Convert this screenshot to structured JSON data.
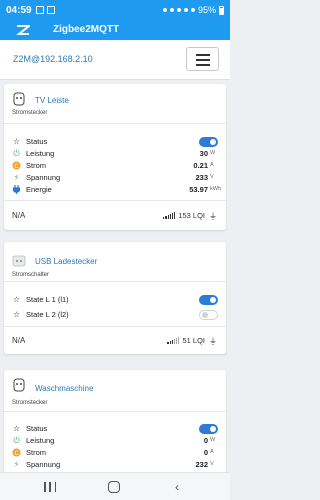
{
  "statusbar": {
    "time": "04:59",
    "battery": "95%"
  },
  "app": {
    "title": "Zigbee2MQTT"
  },
  "subheader": {
    "host": "Z2M@192.168.2.10"
  },
  "devices": [
    {
      "name": "TV Leiste",
      "type": "Stromstecker",
      "rows": [
        {
          "label": "Status",
          "toggle": "on"
        },
        {
          "label": "Leistung",
          "value": "30",
          "unit": "W"
        },
        {
          "label": "Strom",
          "value": "0.21",
          "unit": "A"
        },
        {
          "label": "Spannung",
          "value": "233",
          "unit": "V"
        },
        {
          "label": "Energie",
          "value": "53.97",
          "unit": "kWh"
        }
      ],
      "footer": {
        "status": "N/A",
        "lqi": "153 LQI"
      }
    },
    {
      "name": "USB Ladestecker",
      "type": "Stromschalter",
      "rows": [
        {
          "label": "State L 1 (l1)",
          "toggle": "on"
        },
        {
          "label": "State L 2 (l2)",
          "toggle": "off"
        }
      ],
      "footer": {
        "status": "N/A",
        "lqi": "51 LQI"
      }
    },
    {
      "name": "Waschmaschine",
      "type": "Stromstecker",
      "rows": [
        {
          "label": "Status",
          "toggle": "on"
        },
        {
          "label": "Leistung",
          "value": "0",
          "unit": "W"
        },
        {
          "label": "Strom",
          "value": "0",
          "unit": "A"
        },
        {
          "label": "Spannung",
          "value": "232",
          "unit": "V"
        }
      ]
    }
  ],
  "colors": {
    "primary": "#1e9bf0",
    "link": "#2a7ab8",
    "toggle_on": "#2b7bd7",
    "power_icon": "#3cb44b",
    "current_icon": "#f0a030",
    "voltage_icon": "#3cb44b",
    "energy_icon": "#2b7bd7"
  }
}
